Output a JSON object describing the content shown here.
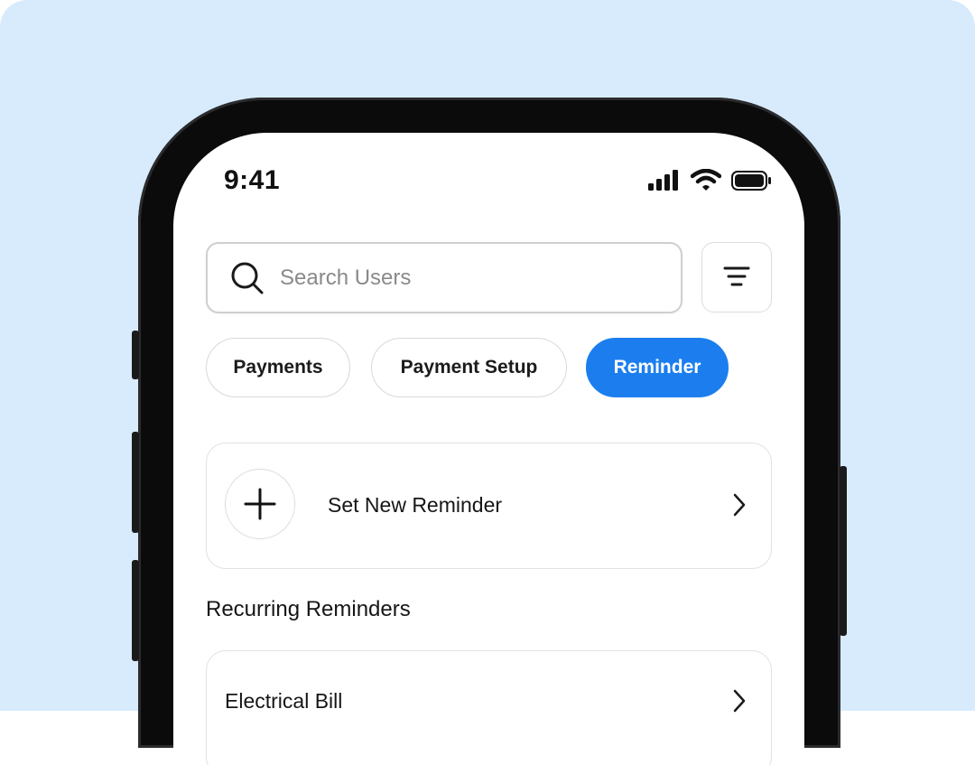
{
  "status_bar": {
    "time": "9:41",
    "icons": [
      "cellular-signal-icon",
      "wifi-icon",
      "battery-icon"
    ]
  },
  "search": {
    "placeholder": "Search Users",
    "icon": "search-icon"
  },
  "filter": {
    "icon": "filter-icon"
  },
  "tabs": [
    {
      "label": "Payments",
      "active": false
    },
    {
      "label": "Payment Setup",
      "active": false
    },
    {
      "label": "Reminder",
      "active": true
    }
  ],
  "new_reminder": {
    "label": "Set New Reminder",
    "icon": "plus-icon",
    "chevron": "chevron-right-icon"
  },
  "recurring": {
    "title": "Recurring Reminders",
    "items": [
      {
        "label": "Electrical Bill"
      }
    ]
  },
  "colors": {
    "background": "#d7ebfc",
    "accent": "#1c7eee",
    "frame": "#0b0b0c"
  }
}
